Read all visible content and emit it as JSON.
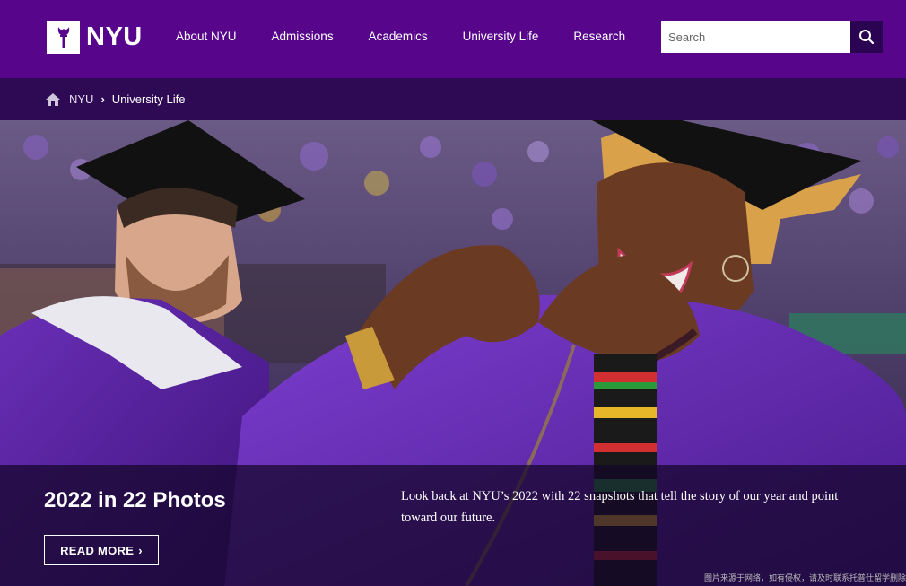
{
  "header": {
    "logo_text": "NYU",
    "nav": [
      "About NYU",
      "Admissions",
      "Academics",
      "University Life",
      "Research"
    ],
    "search_placeholder": "Search"
  },
  "breadcrumb": {
    "items": [
      "NYU",
      "University Life"
    ],
    "separator": "›"
  },
  "hero": {
    "title": "2022 in 22 Photos",
    "button_label": "READ MORE",
    "description": "Look back at NYU’s 2022 with 22 snapshots that tell the story of our year and point toward our future.",
    "watermark": "图片来源于网络，如有侵权，请及时联系托普仕留学删除"
  },
  "colors": {
    "brand_purple": "#57068c",
    "breadcrumb_bg": "#2e0a55",
    "search_button_bg": "#2a0352"
  },
  "icons": [
    "torch-logo-icon",
    "search-icon",
    "home-icon",
    "chevron-right-icon"
  ]
}
